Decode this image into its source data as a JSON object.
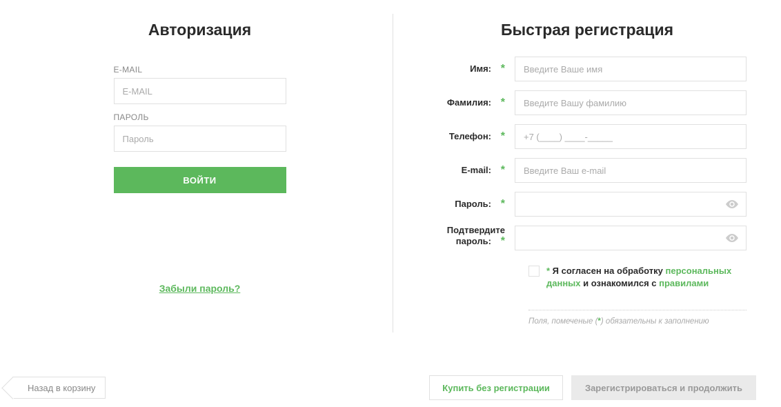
{
  "auth": {
    "heading": "Авторизация",
    "email_label": "E-MAIL",
    "email_placeholder": "E-MAIL",
    "password_label": "ПАРОЛЬ",
    "password_placeholder": "Пароль",
    "login_button": "ВОЙТИ",
    "forgot_link": "Забыли пароль?"
  },
  "reg": {
    "heading": "Быстрая регистрация",
    "fields": {
      "name": {
        "label": "Имя:",
        "placeholder": "Введите Ваше имя"
      },
      "surname": {
        "label": "Фамилия:",
        "placeholder": "Введите Вашу фамилию"
      },
      "phone": {
        "label": "Телефон:",
        "placeholder": "+7 (____) ____-_____"
      },
      "email": {
        "label": "E-mail:",
        "placeholder": "Введите Ваш e-mail"
      },
      "password": {
        "label": "Пароль:"
      },
      "confirm_l1": "Подтвердите",
      "confirm_l2": "пароль:"
    },
    "consent": {
      "star": "*",
      "t1": " Я согласен на обработку ",
      "link1": "персональных данных",
      "t2": " и ознакомился с ",
      "link2": "правилами"
    },
    "note_p1": "Поля, помеченые (",
    "note_star": "*",
    "note_p2": ") обязательны к заполнению"
  },
  "buttons": {
    "back": "Назад в корзину",
    "buy_no_reg": "Купить без регистрации",
    "register_continue": "Зарегистрироваться и продолжить"
  },
  "star": "*"
}
